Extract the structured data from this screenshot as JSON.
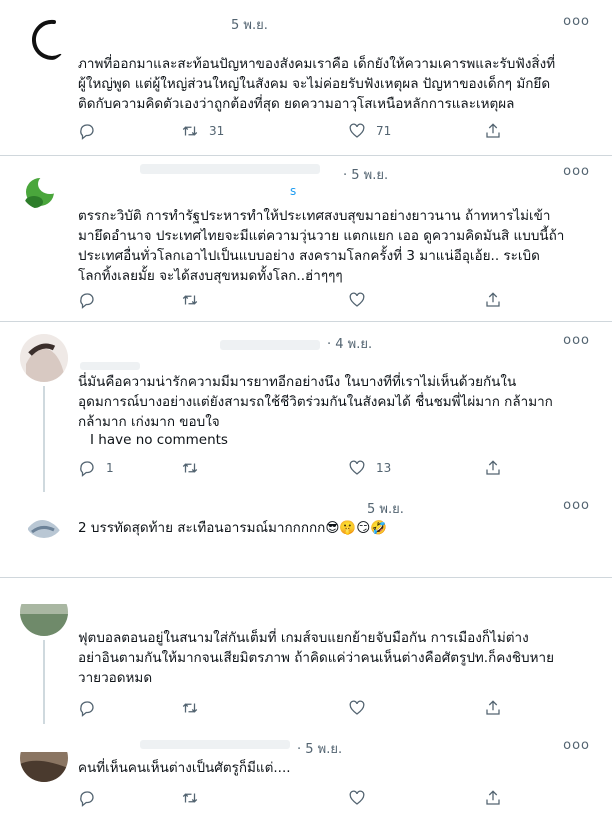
{
  "icons": {
    "reply": "reply-icon",
    "retweet": "retweet-icon",
    "like": "like-icon",
    "share": "share-icon",
    "more": "more-options-icon"
  },
  "more_label": "ooo",
  "tweets": [
    {
      "date": "5 พ.ย.",
      "text": "ภาพที่ออกมาและสะท้อนปัญหาของสังคมเราคือ เด็กยังให้ความเคารพและรับฟังสิ่งที่\nผู้ใหญ่พูด แต่ผู้ใหญ่ส่วนใหญ่ในสังคม จะไม่ค่อยรับฟังเหตุผล ปัญหาของเด็กๆ มักยึด\nติดกับความคิดตัวเองว่าถูกต้องที่สุด ยดความอาวุโสเหนือหลักการและเหตุผล",
      "reply_count": "",
      "retweet_count": "31",
      "like_count": "71"
    },
    {
      "date": "· 5 พ.ย.",
      "handle_fragment": "s",
      "text": "ตรรกะวิบัติ การทำรัฐประหารทำให้ประเทศสงบสุขมาอย่างยาวนาน ถ้าทหารไม่เข้า\nมายึดอำนาจ ประเทศไทยจะมีแต่ความวุ่นวาย แตกแยก เออ ดูความคิดมันสิ แบบนี้ถ้า\nประเทศอื่นทั่วโลกเอาไปเป็นแบบอย่าง สงครามโลกครั้งที่ 3 มาแน่อีอุเอ้ย.. ระเบิด\nโลกทิ้งเลยมั้ย จะได้สงบสุขหมดทั้งโลก..ฮ่าๆๆๆ",
      "reply_count": "",
      "retweet_count": "",
      "like_count": ""
    },
    {
      "date": "· 4 พ.ย.",
      "text": "นี่มันคือความน่ารักความมีมารยาทอีกอย่างนึง ในบางทีที่เราไม่เห็นด้วยกันใน\nอุดมการณ์บางอย่างแต่ยังสามรถใช้ชีวิตร่วมกันในสังคมได้ ชื่นชมพี่ไผ่มาก กล้ามาก\nกล้ามาก เก่งมาก ขอบใจ",
      "subtext": "I have no comments",
      "reply_count": "1",
      "retweet_count": "",
      "like_count": "13"
    },
    {
      "date": "5 พ.ย.",
      "text": "2 บรรทัดสุดท้าย สะเทือนอารมณ์มากกกกก😎🤫😏🤣"
    },
    {
      "text": "ฟุตบอลตอนอยู่ในสนามใส่กันเต็มที่ เกมส์จบแยกย้ายจับมือกัน การเมืองก็ไม่ต่าง\nอย่าอินตามกันให้มากจนเสียมิตรภาพ ถ้าคิดแค่ว่าคนเห็นต่างคือศัตรูปท.ก็คงชิบหาย\nวายวอดหมด",
      "reply_count": "",
      "retweet_count": "",
      "like_count": ""
    },
    {
      "date": "· 5 พ.ย.",
      "text": "คนที่เห็นคนเห็นต่างเป็นศัตรูก็มีแต่....",
      "reply_count": "",
      "retweet_count": "",
      "like_count": ""
    }
  ]
}
